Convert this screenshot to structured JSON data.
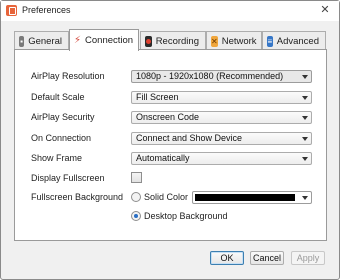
{
  "window": {
    "title": "Preferences",
    "close_glyph": "✕"
  },
  "tabs": [
    {
      "label": "General",
      "icon": "general-icon",
      "icon_color": "#6a6a6a"
    },
    {
      "label": "Connection",
      "icon": "connection-icon",
      "icon_color": "#d2473b"
    },
    {
      "label": "Recording",
      "icon": "record-icon",
      "icon_color": "#c03a2b"
    },
    {
      "label": "Network",
      "icon": "network-icon",
      "icon_color": "#e58a1f"
    },
    {
      "label": "Advanced",
      "icon": "advanced-icon",
      "icon_color": "#2f6fc0"
    }
  ],
  "active_tab": "Connection",
  "settings": {
    "airplay_resolution": {
      "label": "AirPlay Resolution",
      "value": "1080p - 1920x1080 (Recommended)"
    },
    "default_scale": {
      "label": "Default Scale",
      "value": "Fill Screen"
    },
    "airplay_security": {
      "label": "AirPlay Security",
      "value": "Onscreen Code"
    },
    "on_connection": {
      "label": "On Connection",
      "value": "Connect and Show Device"
    },
    "show_frame": {
      "label": "Show Frame",
      "value": "Automatically"
    },
    "display_fullscreen": {
      "label": "Display Fullscreen",
      "checked": false
    },
    "fullscreen_background": {
      "label": "Fullscreen Background",
      "solid_color_label": "Solid Color",
      "solid_color_value": "#000000",
      "desktop_background_label": "Desktop Background",
      "selected": "Desktop Background"
    }
  },
  "buttons": {
    "ok": "OK",
    "cancel": "Cancel",
    "apply": "Apply"
  }
}
